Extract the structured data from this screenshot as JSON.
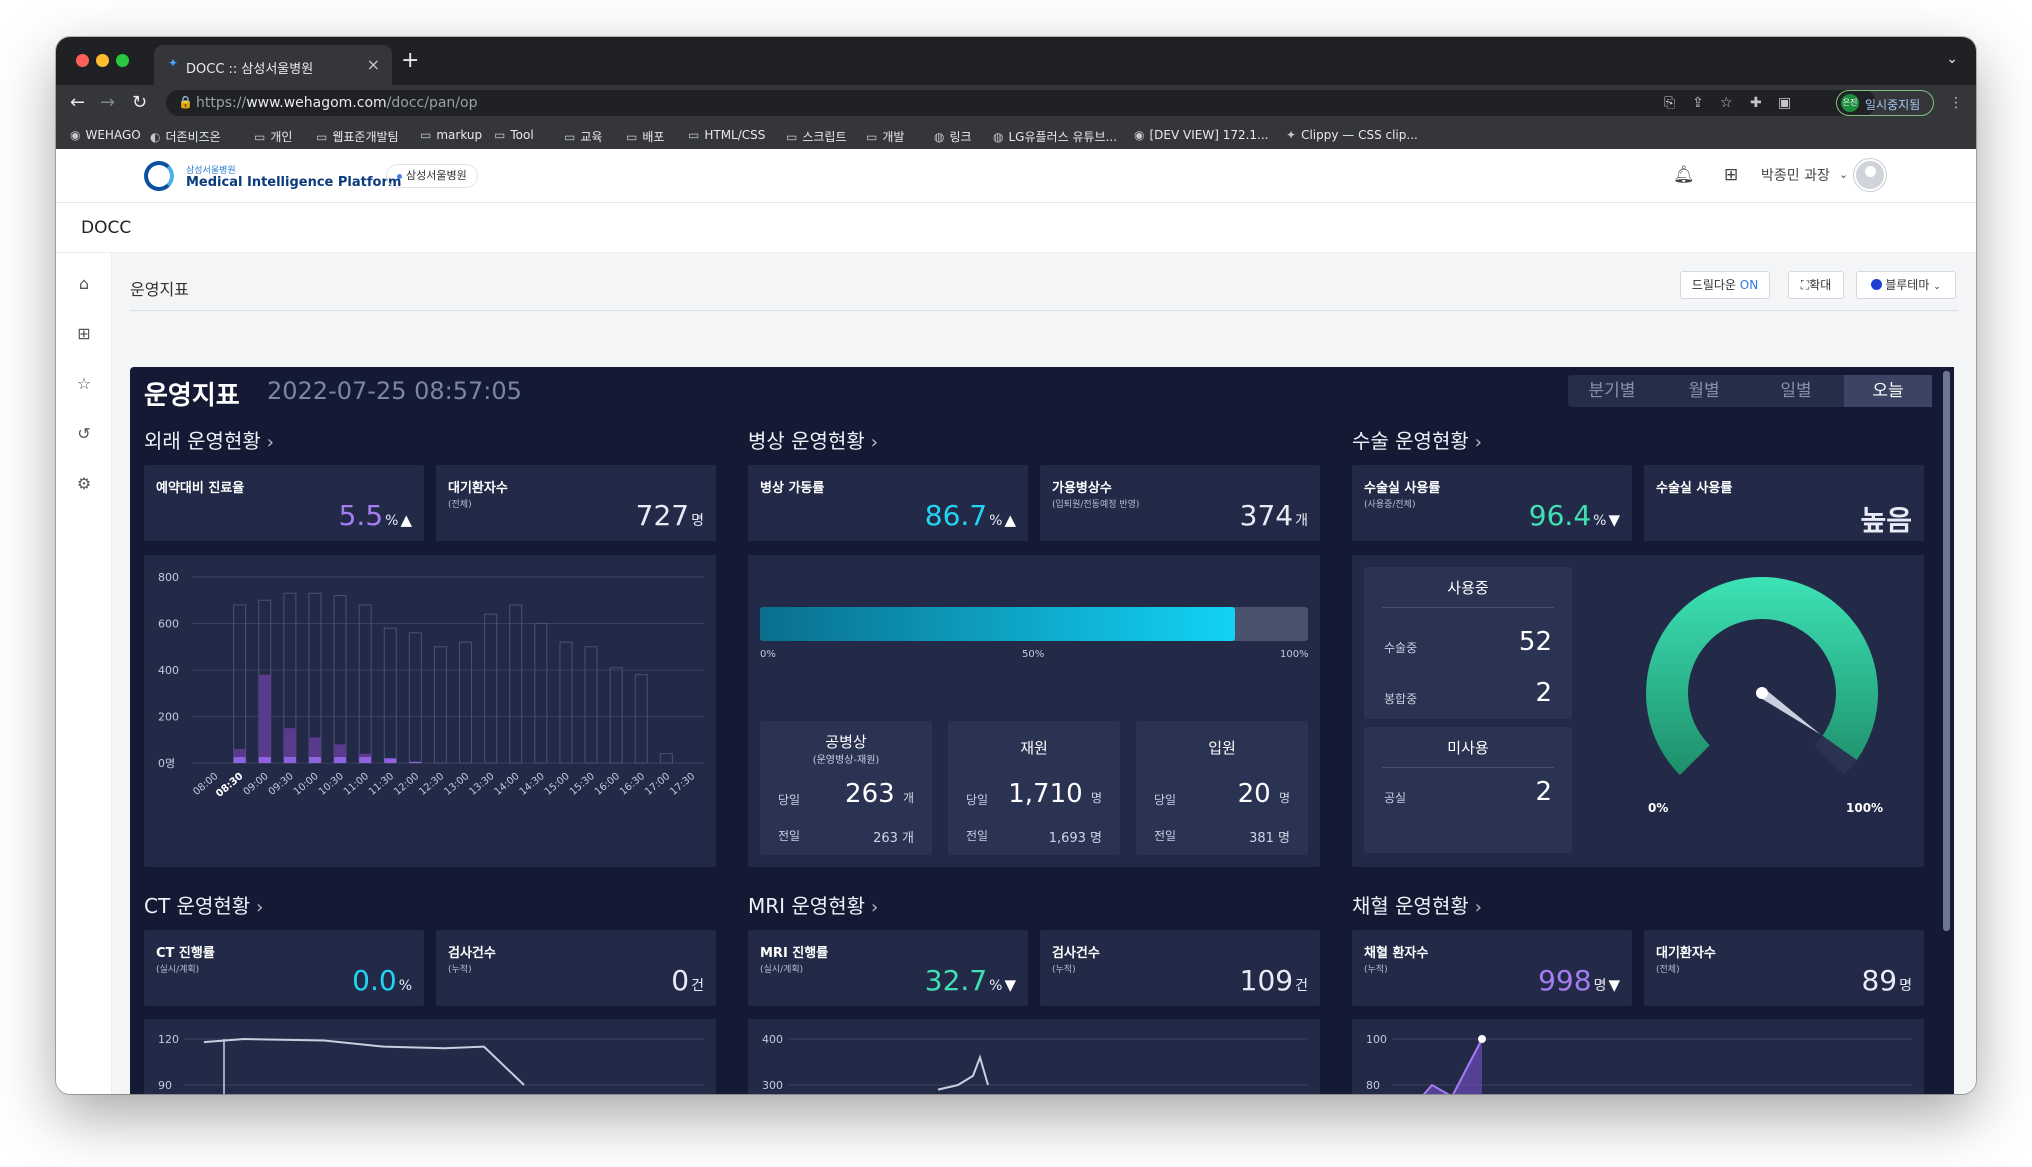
{
  "browser": {
    "tab_title": "DOCC :: 삼성서울병원",
    "url_prefix": "https://",
    "url_host": "www.wehagom.com",
    "url_path": "/docc/pan/op",
    "profile_label": "일시중지됨",
    "profile_badge": "은진",
    "bookmarks": [
      "WEHAGO",
      "더존비즈온",
      "개인",
      "웹표준개발팀",
      "markup",
      "Tool",
      "교육",
      "배포",
      "HTML/CSS",
      "스크립트",
      "개발",
      "링크",
      "LG유플러스 유튜브...",
      "[DEV VIEW] 172.1...",
      "Clippy — CSS clip..."
    ]
  },
  "header": {
    "logo_small": "삼성서울병원",
    "logo_main": "Medical Intelligence Platform",
    "org_chip": "삼성서울병원",
    "user": "박종민 과장"
  },
  "app_title": "DOCC",
  "breadcrumb": "운영지표",
  "controls": {
    "drilldown_label": "드릴다운",
    "drilldown_state": "ON",
    "expand_label": "확대",
    "theme_label": "블루테마"
  },
  "dashboard": {
    "title": "운영지표",
    "datetime": "2022-07-25 08:57:05",
    "periods": [
      "분기별",
      "월별",
      "일별",
      "오늘"
    ],
    "active_period": "오늘",
    "outpatient": {
      "title": "외래 운영현황",
      "card1": {
        "label": "예약대비 진료율",
        "value": "5.5",
        "unit": "%",
        "arrow": "▲",
        "color": "#a57cf2"
      },
      "card2": {
        "label": "대기환자수",
        "sub": "(전체)",
        "value": "727",
        "unit": "명"
      },
      "chart_data": {
        "type": "bar",
        "title": "",
        "ylim": [
          0,
          800
        ],
        "yticks": [
          "800",
          "600",
          "400",
          "200",
          "0명"
        ],
        "categories": [
          "08:00",
          "08:30",
          "09:00",
          "09:30",
          "10:00",
          "10:30",
          "11:00",
          "11:30",
          "12:00",
          "12:30",
          "13:00",
          "13:30",
          "14:00",
          "14:30",
          "15:00",
          "15:30",
          "16:00",
          "16:30",
          "17:00",
          "17:30"
        ],
        "highlight_category": "08:30",
        "series": [
          {
            "values": [
              0,
              60,
              380,
              150,
              110,
              80,
              40,
              20,
              5,
              0,
              0,
              0,
              0,
              0,
              0,
              0,
              0,
              0,
              0,
              0
            ]
          },
          {
            "values": [
              0,
              680,
              700,
              730,
              730,
              720,
              680,
              580,
              560,
              500,
              520,
              640,
              680,
              600,
              520,
              500,
              410,
              380,
              40,
              0
            ]
          }
        ]
      }
    },
    "ward": {
      "title": "병상 운영현황",
      "card1": {
        "label": "병상 가동률",
        "value": "86.7",
        "unit": "%",
        "arrow": "▲",
        "color": "#24d3f0"
      },
      "card2": {
        "label": "가용병상수",
        "sub": "(입퇴원/전동예정 반영)",
        "value": "374",
        "unit": "개"
      },
      "progress": 0.867,
      "progress_ticks": [
        "0%",
        "50%",
        "100%"
      ],
      "boxes": [
        {
          "title": "공병상",
          "subtitle": "(운영병상-재원)",
          "today_label": "당일",
          "today": "263",
          "today_unit": "개",
          "prev_label": "전일",
          "prev": "263 개"
        },
        {
          "title": "재원",
          "subtitle": "",
          "today_label": "당일",
          "today": "1,710",
          "today_unit": "명",
          "prev_label": "전일",
          "prev": "1,693 명"
        },
        {
          "title": "입원",
          "subtitle": "",
          "today_label": "당일",
          "today": "20",
          "today_unit": "명",
          "prev_label": "전일",
          "prev": "381 명"
        }
      ]
    },
    "surgery": {
      "title": "수술 운영현황",
      "card1": {
        "label": "수술실 사용률",
        "sub": "(사용중/전체)",
        "value": "96.4",
        "unit": "%",
        "arrow": "▼",
        "color": "#40e0b5"
      },
      "card2": {
        "label": "수술실 사용률",
        "value": "높음"
      },
      "in_use": {
        "title": "사용중",
        "rows": [
          {
            "label": "수술중",
            "value": "52"
          },
          {
            "label": "봉합중",
            "value": "2"
          }
        ]
      },
      "unused": {
        "title": "미사용",
        "rows": [
          {
            "label": "공실",
            "value": "2"
          }
        ]
      },
      "gauge": {
        "value": 0.964,
        "min_label": "0%",
        "max_label": "100%"
      }
    },
    "ct": {
      "title": "CT 운영현황",
      "card1": {
        "label": "CT 진행률",
        "sub": "(실시/계획)",
        "value": "0.0",
        "unit": "%",
        "color": "#24d3f0"
      },
      "card2": {
        "label": "검사건수",
        "sub": "(누적)",
        "value": "0",
        "unit": "건"
      },
      "chart_data": {
        "type": "line",
        "yticks": [
          "120",
          "90"
        ],
        "series": [
          {
            "values": [
              118,
              120,
              119,
              115,
              114,
              115,
              90
            ]
          }
        ]
      }
    },
    "mri": {
      "title": "MRI 운영현황",
      "card1": {
        "label": "MRI 진행률",
        "sub": "(실시/계획)",
        "value": "32.7",
        "unit": "%",
        "arrow": "▼",
        "color": "#40e0b5"
      },
      "card2": {
        "label": "검사건수",
        "sub": "(누적)",
        "value": "109",
        "unit": "건"
      },
      "chart_data": {
        "type": "line",
        "yticks": [
          "400",
          "300"
        ],
        "series": [
          {
            "values": [
              290,
              300,
              320,
              360,
              300
            ]
          }
        ]
      }
    },
    "blood": {
      "title": "채혈 운영현황",
      "card1": {
        "label": "채혈 환자수",
        "sub": "(누적)",
        "value": "998",
        "unit": "명",
        "arrow": "▼",
        "color": "#a57cf2"
      },
      "card2": {
        "label": "대기환자수",
        "sub": "(전체)",
        "value": "89",
        "unit": "명"
      },
      "chart_data": {
        "type": "area",
        "yticks": [
          "100",
          "80"
        ],
        "series": [
          {
            "values": [
              70,
              80,
              75,
              100
            ]
          }
        ]
      }
    }
  }
}
